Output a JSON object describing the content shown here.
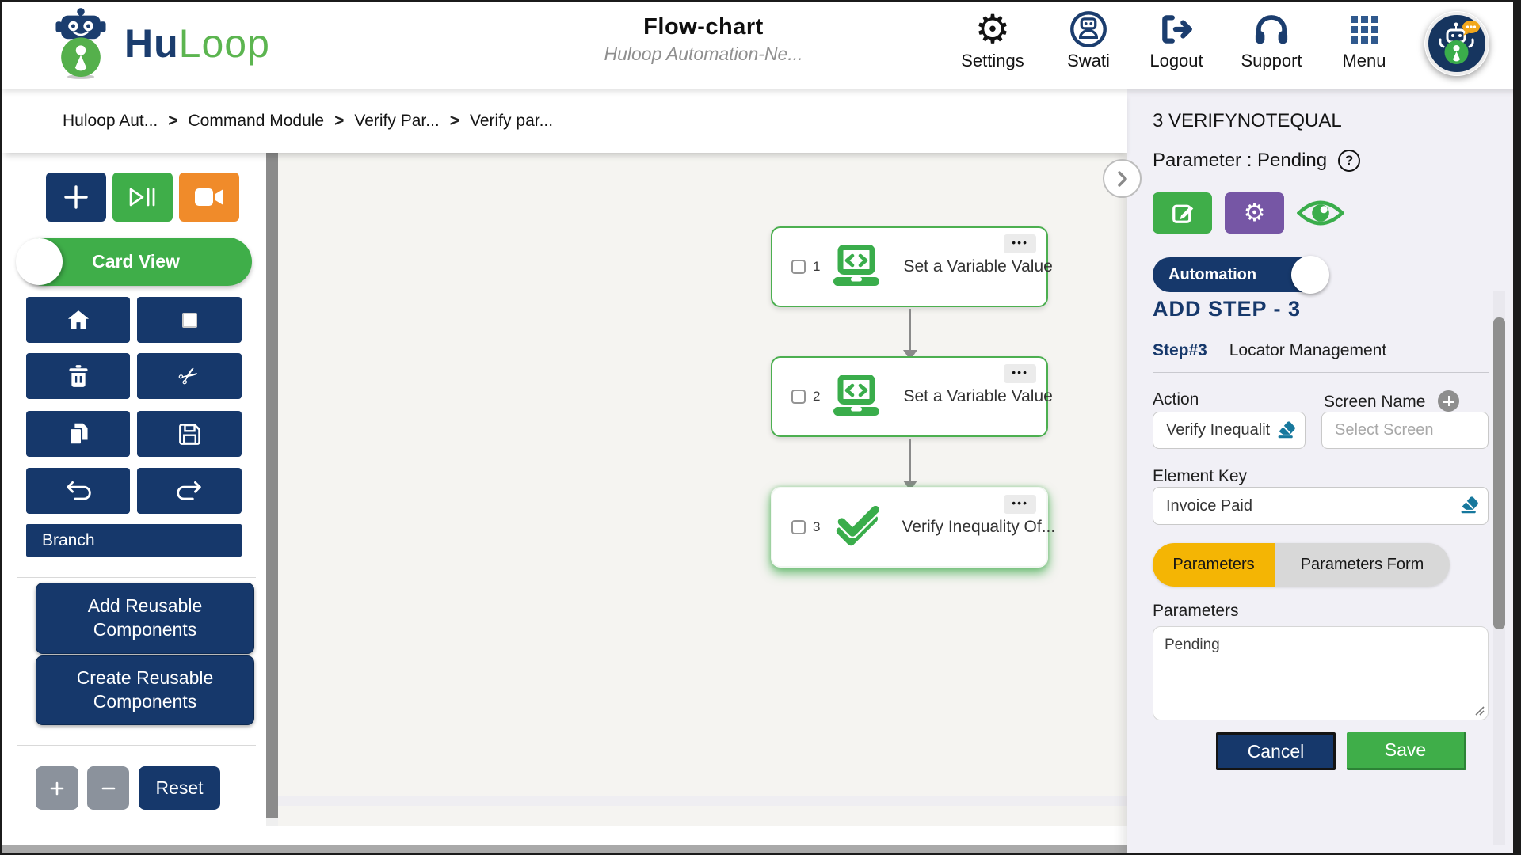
{
  "header": {
    "brand": {
      "primary": "Hu",
      "secondary": "Loop"
    },
    "title": "Flow-chart",
    "subtitle": "Huloop Automation-Ne...",
    "nav": {
      "settings": "Settings",
      "user": "Swati",
      "logout": "Logout",
      "support": "Support",
      "menu": "Menu"
    }
  },
  "breadcrumb": {
    "items": [
      "Huloop Aut...",
      "Command Module",
      "Verify Par...",
      "Verify par..."
    ],
    "separator": ">"
  },
  "sidebar": {
    "card_view": "Card View",
    "branch": "Branch",
    "add_reusable": "Add Reusable Components",
    "create_reusable": "Create Reusable Components",
    "reset": "Reset"
  },
  "flow": {
    "nodes": [
      {
        "num": "1",
        "label": "Set a Variable Value"
      },
      {
        "num": "2",
        "label": "Set a Variable Value"
      },
      {
        "num": "3",
        "label": "Verify Inequality Of..."
      }
    ]
  },
  "panel": {
    "heading": "3 VERIFYNOTEQUAL",
    "parameter_line": "Parameter : Pending",
    "toggle": "Automation",
    "add_step": "ADD STEP - 3",
    "step_no": "Step#3",
    "step_name": "Locator Management",
    "action_label": "Action",
    "action_value": "Verify Inequalit",
    "screen_label": "Screen Name",
    "screen_placeholder": "Select Screen",
    "element_key_label": "Element Key",
    "element_key_value": "Invoice Paid",
    "tab_parameters": "Parameters",
    "tab_parameters_form": "Parameters Form",
    "parameters_label": "Parameters",
    "parameters_value": "Pending",
    "cancel": "Cancel",
    "save": "Save"
  },
  "icons": {
    "gear": "⚙",
    "scissors": "✂",
    "dots": "•••",
    "help": "?"
  },
  "colors": {
    "navy": "#16386b",
    "green": "#3fae49",
    "orange": "#f08b2a",
    "purple": "#7656a5",
    "amber": "#f4b504",
    "teal": "#17789d",
    "panel_bg": "#f1f0f6",
    "canvas_bg": "#f5f4f1"
  }
}
